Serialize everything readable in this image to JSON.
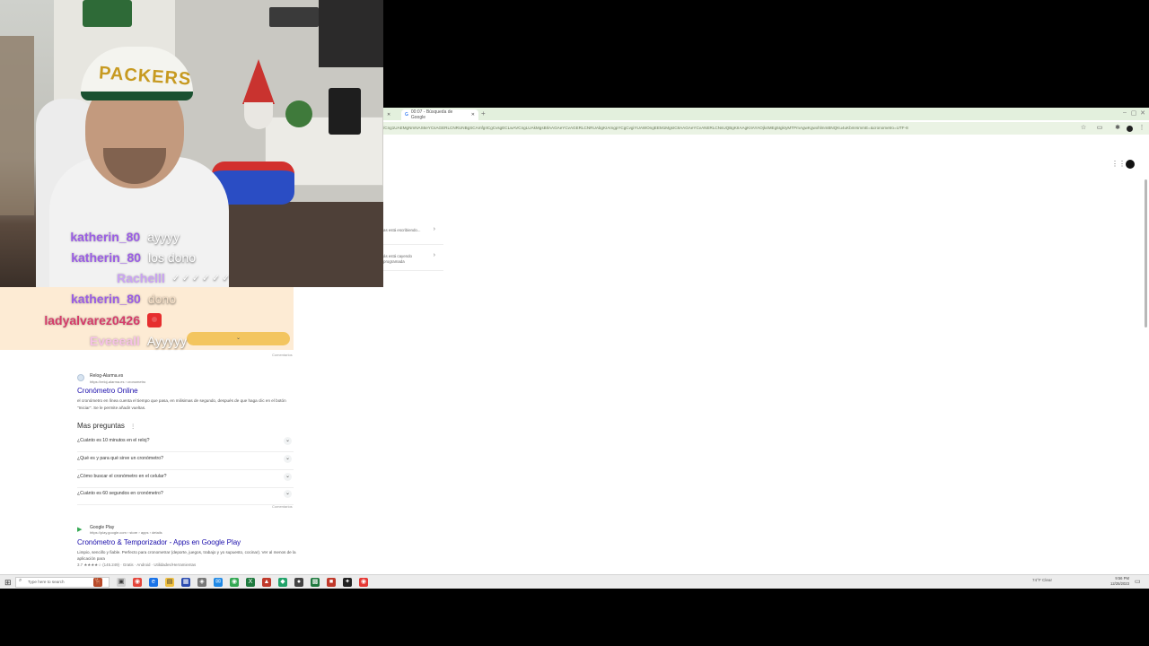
{
  "browser": {
    "tab_title": "00:07 - Búsqueda de Google",
    "new_tab": "+",
    "window_controls": [
      "–",
      "▢",
      "✕"
    ],
    "url": "/Cng1UAEMgNmNAS6eYCsAGERLCNRUNBgSCAmfgIICgCvsgECLwAVCngLUAkMgsBIlAAGAeYCvAGERLCNRUAbgKIAmgpYCgCvgiYUAWOngEEM1MgsIC8AAGAeYCvANERLCNsUQBgKIIAAgKIIAYAOjk4MEg5IgkIyMTPmAgwKgwxhlmmBNQKu4uKbmrsmmE=&cronometro=UTF-8",
    "toolbar_icons": [
      "star-icon",
      "cast-icon",
      "puzzle-icon"
    ],
    "side_cards": [
      {
        "text": "as está escribiendo...",
        "chevron": "›"
      },
      {
        "text": "ás está cayendo programada",
        "chevron": "›"
      }
    ]
  },
  "webcam": {
    "cap_text": "PACKERS"
  },
  "chat": {
    "user_colors": {
      "katherin_80": "#9b5de5",
      "ladyalvarez0426": "#d63b6a",
      "rachel": "#c9a2f2",
      "evee": "#f6c2e6"
    },
    "lines": [
      {
        "user": "katherin_80",
        "message": "ayyyy",
        "emote": false
      },
      {
        "user": "katherin_80",
        "message": "los dono",
        "emote": false
      },
      {
        "user": "Rachelll",
        "message": "✓ ✓ ✓ ✓ ✓ ✓",
        "emote": false
      },
      {
        "user": "katherin_80",
        "message": "dono",
        "emote": false
      },
      {
        "user": "ladyalvarez0426",
        "message": "",
        "emote": true
      },
      {
        "user": "Eveeeall",
        "message": "Ayyyyy",
        "emote": false
      }
    ]
  },
  "results": {
    "comments_label": "Comentarios",
    "result1": {
      "source_name": "Relog-Alarma.es",
      "source_url": "https://reloj-alarma.es › cronometro",
      "title": "Cronómetro Online",
      "snippet": "el cronómetro en línea cuenta el tiempo que pasa, en milisimas de segundo, después de que haga clic en el botón \"Iniciar\". Se le permite añadir vueltas."
    },
    "paa": {
      "title": "Mas preguntas",
      "questions": [
        "¿Cuánto es 10 minutos en el reloj?",
        "¿Qué es y para qué sirve un cronómetro?",
        "¿Cómo buscar el cronómetro en el celular?",
        "¿Cuánto es 60 segundos en cronómetro?"
      ]
    },
    "result2": {
      "source_name": "Google Play",
      "source_url": "https://play.google.com › store › apps › details",
      "title": "Cronómetro & Temporizador - Apps en Google Play",
      "snippet": "Limpio, sencillo y fiable. Perfecto para cronometrar (deporte, juegos, trabajo y yo supuesto, cocinar). Ver al menos de la aplicación para",
      "rating": "3.7 ★★★★☆ (145.249) · Gratis · Android · Utilidades/Herramientas"
    }
  },
  "taskbar": {
    "search_placeholder": "Type here to search",
    "weather": "74°F Clear",
    "time": "9:56 PM",
    "date": "12/25/2023"
  }
}
